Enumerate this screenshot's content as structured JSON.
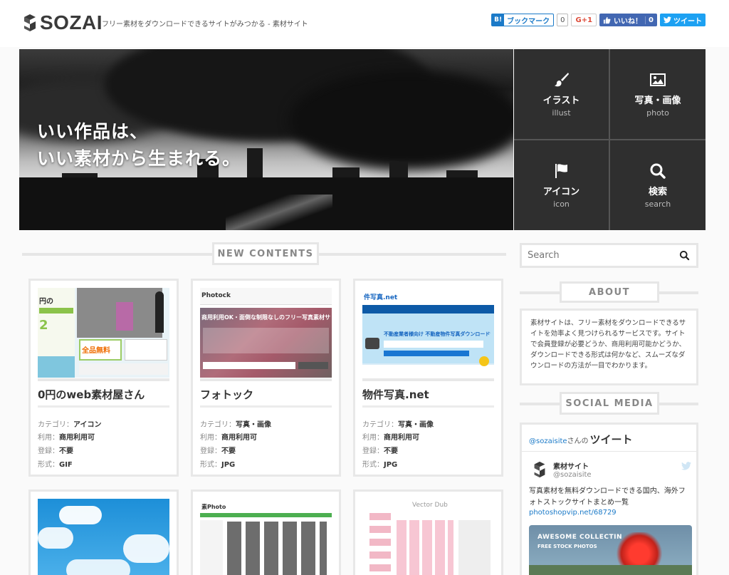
{
  "header": {
    "logo": "SOZAI",
    "tagline": "フリー素材をダウンロードできるサイトがみつかる - 素材サイト",
    "share": {
      "hatena_icon": "B!",
      "hatena_label": "ブックマーク",
      "hatena_count": "0",
      "gplus_label": "G+1",
      "like_label": "いいね！",
      "like_count": "0",
      "tweet_label": "ツイート"
    }
  },
  "hero": {
    "line1": "いい作品は、",
    "line2": "いい素材から生まれる。"
  },
  "categories": [
    {
      "ja": "イラスト",
      "en": "illust",
      "icon": "brush-icon"
    },
    {
      "ja": "写真・画像",
      "en": "photo",
      "icon": "image-icon"
    },
    {
      "ja": "アイコン",
      "en": "icon",
      "icon": "flag-icon"
    },
    {
      "ja": "検索",
      "en": "search",
      "icon": "search-icon"
    }
  ],
  "new_contents": {
    "heading": "NEW CONTENTS",
    "meta_labels": {
      "category": "カテゴリ：",
      "usage": "利用：",
      "registration": "登録：",
      "format": "形式："
    },
    "cards": [
      {
        "title": "0円のweb素材屋さん",
        "category": "アイコン",
        "usage": "商用利用可",
        "registration": "不要",
        "format": "GIF"
      },
      {
        "title": "フォトック",
        "category": "写真・画像",
        "usage": "商用利用可",
        "registration": "不要",
        "format": "JPG"
      },
      {
        "title": "物件写真.net",
        "category": "写真・画像",
        "usage": "商用利用可",
        "registration": "不要",
        "format": "JPG"
      }
    ],
    "thumb_texts": {
      "card1_big": "全品無料",
      "card1_side": "円の",
      "card2_logo": "Photock",
      "card2_headline": "商用利用OK・面倒な制限なしのフリー写真素材サイト",
      "card3_logo": "件写真.net",
      "card3_banner": "不動産業者様向け 不動産物件写真ダウンロードサイト",
      "card5_logo": "素Photo",
      "card6_logo": "Vector Dub"
    }
  },
  "sidebar": {
    "search_placeholder": "Search",
    "about_heading": "ABOUT",
    "about_text": "素材サイトは、フリー素材をダウンロードできるサイトを効率よく見つけられるサービスです。サイトで会員登録が必要どうか、商用利用可能かどうか、ダウンロードできる形式は何かなど、スムーズなダウンロードの方法が一目でわかります。",
    "social_heading": "SOCIAL MEDIA",
    "twitter": {
      "handle_prefix": "@sozaisite",
      "handle_suffix": "さんの",
      "title": "ツイート",
      "name": "素材サイト",
      "screen_name": "@sozaisite",
      "tweet": "写真素材を無料ダウンロードできる国内、海外フォトストックサイトまとめ一覧",
      "link": "photoshopvip.net/68729",
      "image_line1": "AWESOME COLLECTIN",
      "image_line2": "FREE STOCK PHOTOS"
    }
  },
  "colors": {
    "accent_blue": "#1b7ac8",
    "twitter_blue": "#1da1f2",
    "facebook_blue": "#4267b2",
    "tile_bg": "#2f2f2f",
    "border": "#e6e6e6"
  }
}
